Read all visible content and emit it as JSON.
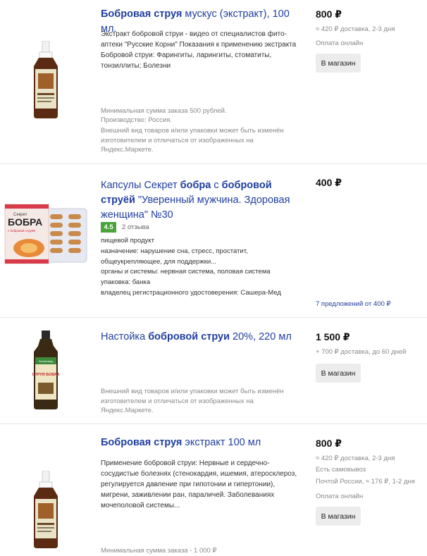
{
  "products": [
    {
      "title_bold": "Бобровая струя",
      "title_rest": " мускус (экстракт), 100 мл.",
      "description": "Экстракт бобровой струи - видео от специалистов фито-аптеки \"Русские Корни\" Показания к применению экстракта Бобровой струи: Фарингиты, ларингиты, стоматиты, тонзиллиты; Болезни",
      "meta": [
        "Минимальная сумма заказа 500 рублей.",
        "Производство: Россия.",
        "Внешний вид товаров и/или упаковки может быть изменён изготовителем и отличаться от изображенных на Яндекс.Маркете."
      ],
      "price": "800 ₽",
      "shipping": [
        "≈ 420 ₽ доставка, 2-3 дня",
        "Оплата онлайн"
      ],
      "button": "В магазин"
    },
    {
      "title_parts": [
        "Капсулы Секрет ",
        "бобра",
        " с ",
        "бобровой струёй",
        " \"Уверенный мужчина. Здоровая женщина\" №30"
      ],
      "rating": "4.5",
      "reviews": "2 отзыва",
      "features": [
        "пищевой продукт",
        "назначение: нарушение сна, стресс, простатит, общеукрепляющее, для поддержки...",
        "органы и системы: нервная система, половая система",
        "упаковка: банка",
        "владелец регистрационного удостоверения: Сашера-Мед"
      ],
      "price": "400 ₽",
      "offers": "7 предложений от 400 ₽",
      "package_brand": "Секрет",
      "package_name": "БОБРА",
      "package_sub": "с бобровой струёй"
    },
    {
      "title_plain": "Настойка ",
      "title_bold": "бобровой струи",
      "title_rest": " 20%, 220 мл",
      "meta": [
        "Внешний вид товаров и/или упаковки может быть изменён изготовителем и отличаться от изображенных на Яндекс.Маркете."
      ],
      "price": "1 500 ₽",
      "shipping": [
        "+ 700 ₽ доставка, до 60 дней"
      ],
      "button": "В магазин",
      "bottle_label_top": "Зеленовед",
      "bottle_label": "СТРУЯ БОБРА"
    },
    {
      "title_bold": "Бобровая струя",
      "title_rest": " экстракт 100 мл",
      "description": "Применение бобровой струи: Нервные и сердечно-сосудистые болезнях (стенокардия, ишемия, атеросклероз, регулируется давление при гипотонии и гипертонии), мигрени, заживлении ран, параличей. Заболеваниях мочеполовой системы...",
      "meta": [
        "Минимальная сумма заказа - 1 000 ₽"
      ],
      "price": "800 ₽",
      "shipping": [
        "≈ 420 ₽ доставка, 2-3 дня",
        "Есть самовывоз",
        "Почтой России, ≈ 176 ₽, 1-2 дня",
        "Оплата онлайн"
      ],
      "button": "В магазин"
    }
  ]
}
